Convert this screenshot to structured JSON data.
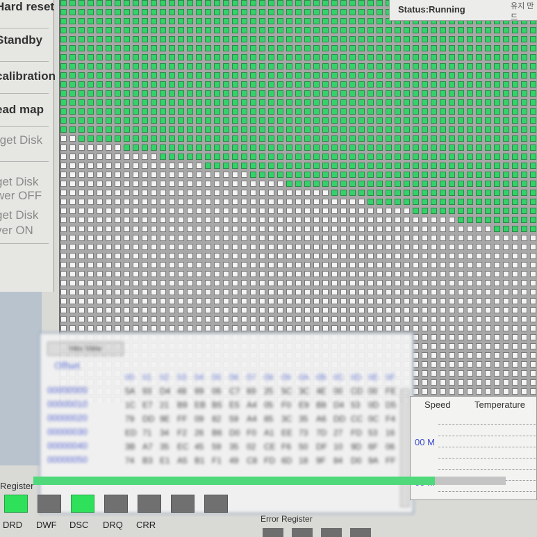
{
  "left_panel": {
    "buttons": [
      {
        "label": "Hard reset",
        "dim": false
      },
      {
        "label": "Standby",
        "dim": false
      },
      {
        "label": "calibration",
        "dim": false
      },
      {
        "label": "ead map",
        "dim": false
      },
      {
        "label": "rget Disk",
        "dim": true
      },
      {
        "label": "get Disk",
        "dim": true
      },
      {
        "label": "wer OFF",
        "dim": true
      },
      {
        "label": "get Disk",
        "dim": true
      },
      {
        "label": "ver ON",
        "dim": true
      }
    ]
  },
  "status": {
    "label": "Status:",
    "value": "Running",
    "corner": "유지 만드"
  },
  "block_map": {
    "completed_fraction": 0.33,
    "done_color": "#34d26a",
    "todo_color": "#f4f4f4"
  },
  "hex_view": {
    "tab_label": "Hex View",
    "offset_label": "Offset",
    "columns": [
      "00",
      "01",
      "02",
      "03",
      "04",
      "05",
      "06",
      "07",
      "08",
      "09",
      "0A",
      "0B",
      "0C",
      "0D",
      "0E",
      "0F"
    ],
    "rows": [
      {
        "offset": "00000000",
        "bytes": [
          "5A",
          "93",
          "D4",
          "48",
          "99",
          "06",
          "C7",
          "69",
          "25",
          "5C",
          "3C",
          "4E",
          "00",
          "CD",
          "00",
          "FE"
        ]
      },
      {
        "offset": "00000010",
        "bytes": [
          "1C",
          "E7",
          "21",
          "B9",
          "EB",
          "B5",
          "E5",
          "A4",
          "05",
          "F0",
          "E9",
          "B8",
          "D4",
          "53",
          "0D",
          "D5"
        ]
      },
      {
        "offset": "00000020",
        "bytes": [
          "79",
          "DD",
          "9E",
          "FF",
          "09",
          "82",
          "59",
          "A4",
          "85",
          "3C",
          "35",
          "A6",
          "DD",
          "CC",
          "0C",
          "F4"
        ]
      },
      {
        "offset": "00000030",
        "bytes": [
          "ED",
          "71",
          "34",
          "F2",
          "26",
          "B6",
          "D0",
          "F0",
          "A1",
          "EE",
          "73",
          "7D",
          "27",
          "FD",
          "53",
          "16"
        ]
      },
      {
        "offset": "00000040",
        "bytes": [
          "3B",
          "A7",
          "35",
          "EC",
          "45",
          "59",
          "35",
          "02",
          "CE",
          "F6",
          "50",
          "DF",
          "10",
          "9D",
          "6F",
          "06"
        ]
      },
      {
        "offset": "00000050",
        "bytes": [
          "74",
          "B3",
          "E1",
          "A5",
          "B1",
          "F1",
          "49",
          "C8",
          "FD",
          "6D",
          "18",
          "9F",
          "84",
          "D0",
          "9A",
          "FF"
        ]
      }
    ]
  },
  "stats": {
    "headers": [
      "Speed",
      "Temperature"
    ],
    "speed_values": [
      "00 M",
      "00 M"
    ]
  },
  "register": {
    "label": "Register",
    "progress_fraction": 0.85,
    "leds": [
      {
        "label": "DRD",
        "on": true
      },
      {
        "label": "DWF",
        "on": false
      },
      {
        "label": "DSC",
        "on": true
      },
      {
        "label": "DRQ",
        "on": false
      },
      {
        "label": "CRR",
        "on": false
      },
      {
        "label": "",
        "on": false
      },
      {
        "label": "",
        "on": false
      }
    ],
    "error_label": "Error Register"
  }
}
